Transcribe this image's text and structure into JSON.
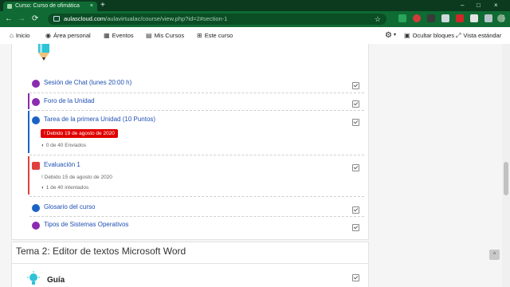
{
  "browser": {
    "tab_title": "Curso: Curso de ofimática",
    "tab_close": "×",
    "new_tab": "+",
    "win_min": "–",
    "win_max": "□",
    "win_close": "×",
    "back": "←",
    "forward": "→",
    "reload": "⟳",
    "url_domain": "aulascloud.com",
    "url_path": "/aulavirtualac/course/view.php?id=2#section-1",
    "star": "☆",
    "menu": "⋮",
    "accent": "#0f6b33"
  },
  "navbar": {
    "items": [
      {
        "label": "Inicio",
        "icon": "home-icon"
      },
      {
        "label": "Área personal",
        "icon": "dashboard-icon"
      },
      {
        "label": "Eventos",
        "icon": "calendar-icon"
      },
      {
        "label": "Mis Cursos",
        "icon": "folder-icon"
      },
      {
        "label": "Este curso",
        "icon": "sitemap-icon"
      }
    ],
    "gear": "⚙",
    "hide_blocks": "Ocultar bloques",
    "standard_view": "Vista estándar"
  },
  "section1": {
    "activities": [
      {
        "name": "Sesión de Chat (lunes 20:00 h)",
        "icon": "chat-icon",
        "color": "#8b2bb0"
      },
      {
        "name": "Foro de la Unidad",
        "icon": "forum-icon",
        "color": "#8b2bb0"
      },
      {
        "name": "Tarea de la primera Unidad (10 Puntos)",
        "icon": "assignment-icon",
        "color": "#1a63c4",
        "due": "Debido 19 de agosto de 2020",
        "info": "0 de 40 Enviados"
      },
      {
        "name": "Evaluación 1",
        "icon": "quiz-icon",
        "color": "#e0403c",
        "due": "Debido 15 de agosto de 2020",
        "info": "1 de 40 intentados"
      },
      {
        "name": "Glosario del curso",
        "icon": "glossary-icon",
        "color": "#1a63c4"
      },
      {
        "name": "Tipos de Sistemas Operativos",
        "icon": "page-icon",
        "color": "#8b2bb0"
      }
    ]
  },
  "section2": {
    "title": "Tema 2: Editor de textos Microsoft Word",
    "first_item": "Guía"
  },
  "misc": {
    "to_top": "^"
  }
}
